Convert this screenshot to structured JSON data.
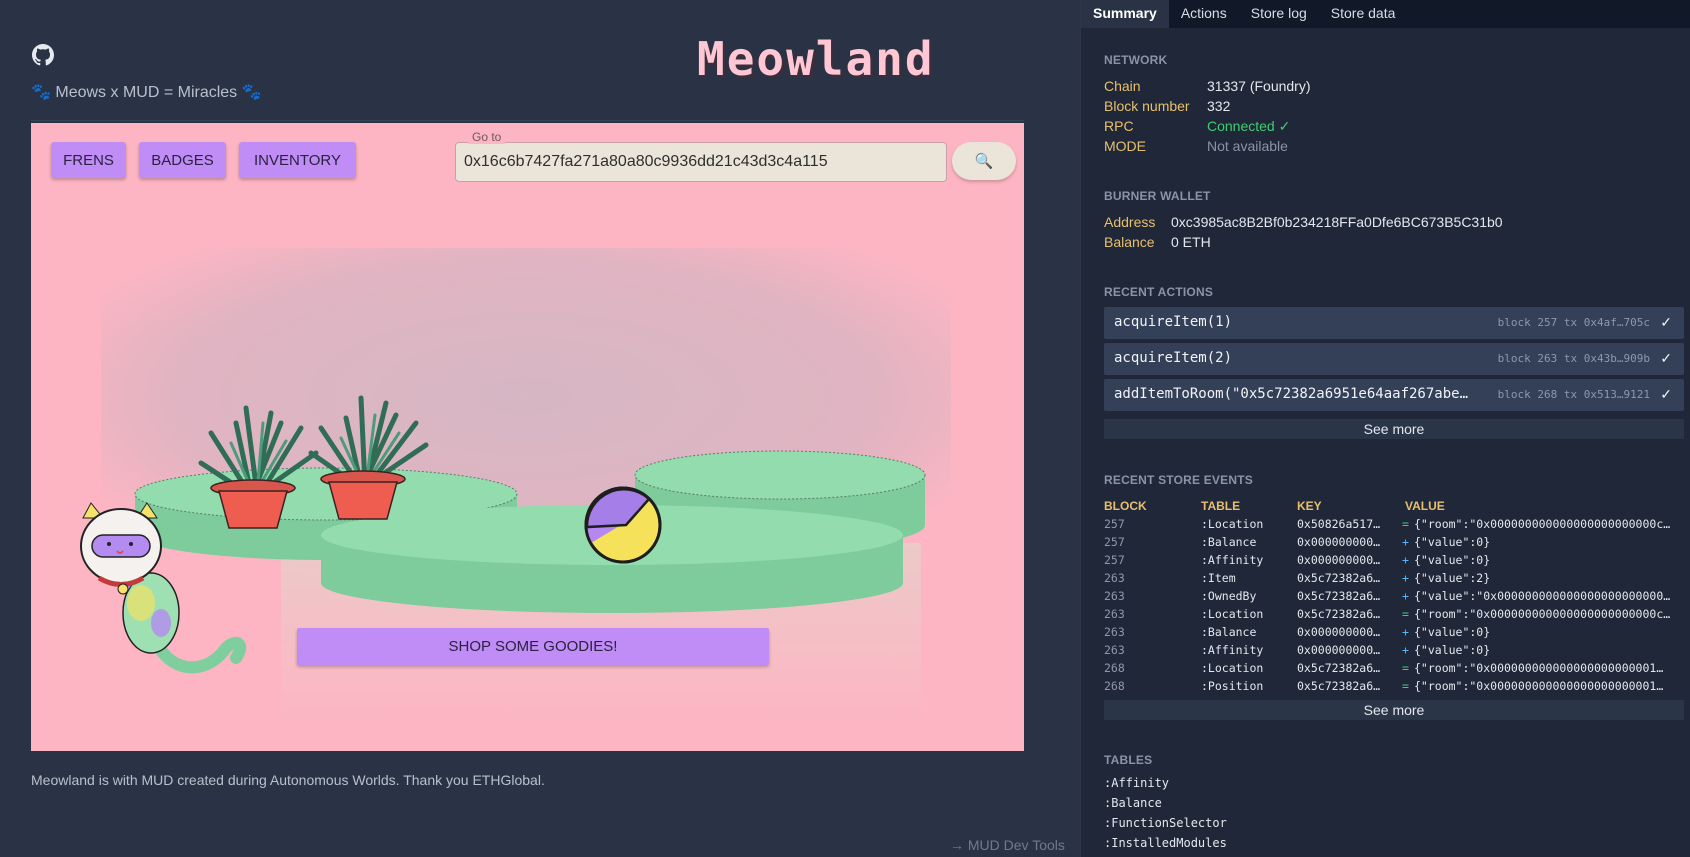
{
  "app": {
    "tagline": "🐾 Meows x MUD = Miracles 🐾",
    "logo": "Meowland",
    "nav": {
      "frens": "FRENS",
      "badges": "BADGES",
      "inventory": "INVENTORY"
    },
    "goto": {
      "label": "Go to",
      "value": "0x16c6b7427fa271a80a80c9936dd21c43d3c4a115"
    },
    "search_icon": "🔍",
    "shop_label": "SHOP SOME GOODIES!",
    "footer_note": "Meowland is with MUD created during Autonomous Worlds. Thank you ETHGlobal.",
    "devtools_link": "→ MUD Dev Tools",
    "colors": {
      "scene_bg": "#fdb5c3",
      "accent": "#c08cf5",
      "platform": "#8fd6a8"
    }
  },
  "devtools": {
    "tabs": [
      "Summary",
      "Actions",
      "Store log",
      "Store data"
    ],
    "network": {
      "title": "NETWORK",
      "rows": [
        {
          "key": "Chain",
          "value": "31337 (Foundry)"
        },
        {
          "key": "Block number",
          "value": "332"
        },
        {
          "key": "RPC",
          "value": "Connected ✓"
        },
        {
          "key": "MODE",
          "value": "Not available"
        }
      ]
    },
    "wallet": {
      "title": "BURNER WALLET",
      "rows": [
        {
          "key": "Address",
          "value": "0xc3985ac8B2Bf0b234218FFa0Dfe6BC673B5C31b0"
        },
        {
          "key": "Balance",
          "value": "0 ETH"
        }
      ]
    },
    "recent_actions": {
      "title": "RECENT ACTIONS",
      "items": [
        {
          "name": "acquireItem(1)",
          "meta": "block 257 tx 0x4af…705c",
          "status": "✓"
        },
        {
          "name": "acquireItem(2)",
          "meta": "block 263 tx 0x43b…909b",
          "status": "✓"
        },
        {
          "name": "addItemToRoom(\"0x5c72382a6951e64aaf267abe…",
          "meta": "block 268 tx 0x513…9121",
          "status": "✓"
        }
      ],
      "see_more": "See more"
    },
    "store_events": {
      "title": "RECENT STORE EVENTS",
      "columns": [
        "BLOCK",
        "TABLE",
        "KEY",
        "VALUE"
      ],
      "rows": [
        {
          "block": "257",
          "table": ":Location",
          "key": "0x50826a517…",
          "op": "=",
          "value": "{\"room\":\"0x000000000000000000000000c…"
        },
        {
          "block": "257",
          "table": ":Balance",
          "key": "0x000000000…",
          "op": "+",
          "value": "{\"value\":0}"
        },
        {
          "block": "257",
          "table": ":Affinity",
          "key": "0x000000000…",
          "op": "+",
          "value": "{\"value\":0}"
        },
        {
          "block": "263",
          "table": ":Item",
          "key": "0x5c72382a6…",
          "op": "+",
          "value": "{\"value\":2}"
        },
        {
          "block": "263",
          "table": ":OwnedBy",
          "key": "0x5c72382a6…",
          "op": "+",
          "value": "{\"value\":\"0x000000000000000000000000…"
        },
        {
          "block": "263",
          "table": ":Location",
          "key": "0x5c72382a6…",
          "op": "=",
          "value": "{\"room\":\"0x000000000000000000000000c…"
        },
        {
          "block": "263",
          "table": ":Balance",
          "key": "0x000000000…",
          "op": "+",
          "value": "{\"value\":0}"
        },
        {
          "block": "263",
          "table": ":Affinity",
          "key": "0x000000000…",
          "op": "+",
          "value": "{\"value\":0}"
        },
        {
          "block": "268",
          "table": ":Location",
          "key": "0x5c72382a6…",
          "op": "=",
          "value": "{\"room\":\"0x000000000000000000000001…"
        },
        {
          "block": "268",
          "table": ":Position",
          "key": "0x5c72382a6…",
          "op": "=",
          "value": "{\"room\":\"0x000000000000000000000001…"
        }
      ],
      "see_more": "See more"
    },
    "tables": {
      "title": "TABLES",
      "items": [
        ":Affinity",
        ":Balance",
        ":FunctionSelector",
        ":InstalledModules"
      ]
    }
  }
}
